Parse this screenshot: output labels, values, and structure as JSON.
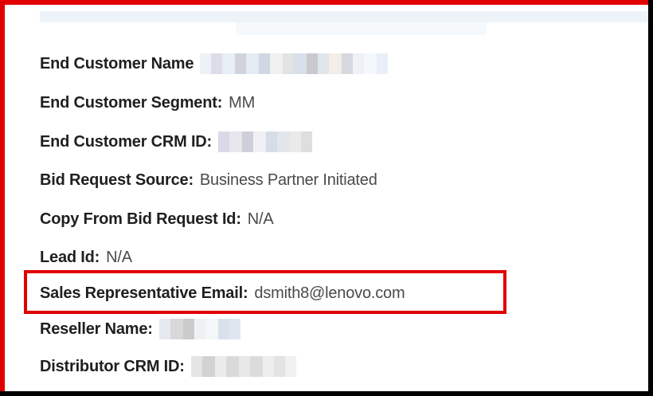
{
  "fields": [
    {
      "label": "End Customer Name",
      "colon": "",
      "value": "",
      "redacted": true
    },
    {
      "label": "End Customer Segment",
      "colon": ":",
      "value": "MM",
      "redacted": false
    },
    {
      "label": "End Customer CRM ID",
      "colon": ":",
      "value": "",
      "redacted": true
    },
    {
      "label": "Bid Request Source",
      "colon": ":",
      "value": "Business Partner Initiated",
      "redacted": false
    },
    {
      "label": "Copy From Bid Request Id",
      "colon": ":",
      "value": "N/A",
      "redacted": false
    },
    {
      "label": "Lead Id",
      "colon": ":",
      "value": "N/A",
      "redacted": false
    },
    {
      "label": "Sales Representative Email",
      "colon": ":",
      "value": "dsmith8@lenovo.com",
      "redacted": false
    },
    {
      "label": "Reseller Name",
      "colon": ":",
      "value": "",
      "redacted": true
    },
    {
      "label": "Distributor CRM ID",
      "colon": ":",
      "value": "",
      "redacted": true
    }
  ],
  "colors": {
    "highlight": "#e00000",
    "label": "#1f1f1f",
    "value": "#4a4a4a"
  }
}
